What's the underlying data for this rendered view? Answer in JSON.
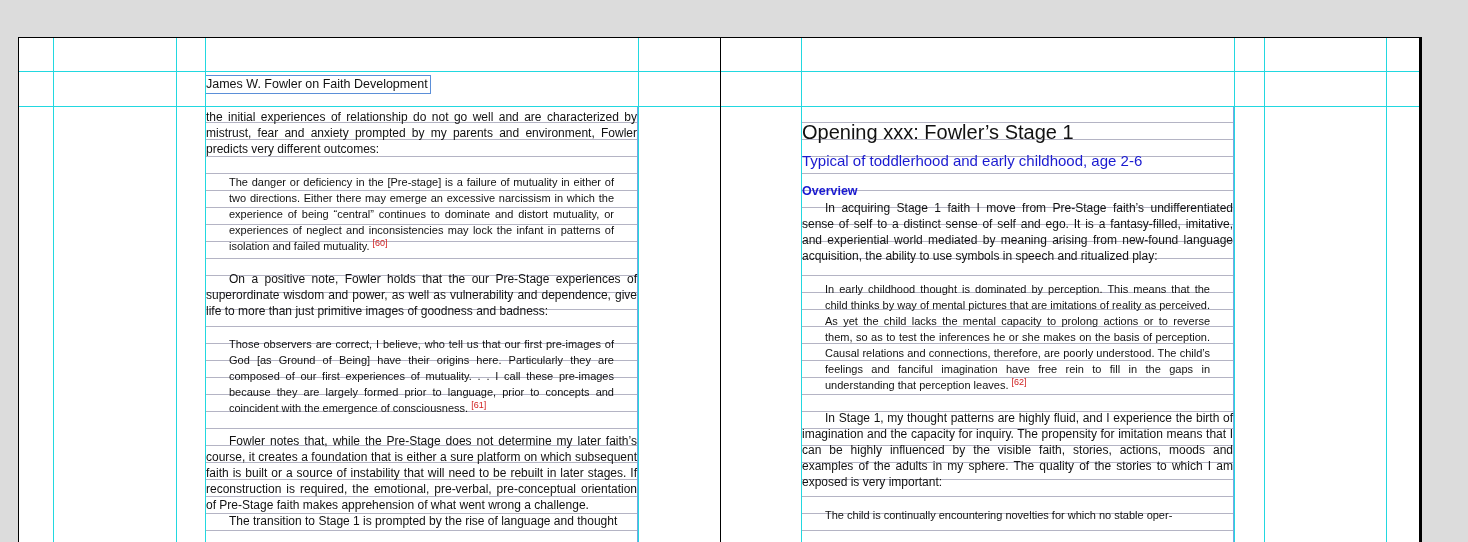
{
  "left_page": {
    "running_head": "James W. Fowler on Faith Development",
    "paragraphs": [
      {
        "kind": "continuation",
        "text": "the initial experiences of relationship do not go well and are characterized by mistrust, fear and anxiety prompted by my parents and environment, Fowler predicts very different outcomes:"
      },
      {
        "kind": "quote",
        "text": "The danger or deficiency in the [Pre-stage] is a failure of mutuality in either of two directions. Either there may emerge an excessive narcissism in which the experience of being “central” continues to dominate and distort mutuality, or experiences of neglect and inconsistencies may lock the infant in patterns of isolation and failed mutuality. $^{[60]}$"
      },
      {
        "kind": "body",
        "text": "On a positive note, Fowler holds that the our Pre-Stage experiences of superordinate wisdom and power, as well as vulnerability and dependence, give life to more than just primitive images of goodness and badness:"
      },
      {
        "kind": "quote",
        "text": "Those observers are correct, I believe, who tell us that our first pre-images of God [as Ground of Being] have their origins here. Particularly they are composed of our first experiences of mutuality. . . I call these pre-images because they are largely formed prior to language, prior to concepts and coincident with the emergence of consciousness. $^{[61]}$"
      },
      {
        "kind": "body",
        "text": "Fowler notes that, while the Pre-Stage does not determine my later faith’s course, it creates a foundation that is either a sure platform on which subsequent faith is built or a source of instability that will need to be rebuilt in later stages. If reconstruction is required, the emotional, pre-verbal, pre-conceptual orientation of Pre-Stage faith makes apprehension of what went wrong a challenge."
      },
      {
        "kind": "body-tight",
        "text": "The transition to Stage 1 is prompted by the rise of language and thought"
      }
    ]
  },
  "right_page": {
    "title": "Opening xxx: Fowler’s Stage 1",
    "subtitle": "Typical of toddlerhood and early childhood, age 2-6",
    "subheading": "Overview",
    "paragraphs": [
      {
        "kind": "body-tight",
        "text": "In acquiring Stage 1 faith I move from Pre-Stage faith’s undifferentiated sense of self to a distinct sense of self and ego. It is a fantasy-filled, imitative, and experiential world mediated by meaning arising from new-found language acquisition, the ability to use symbols in speech and ritualized play:"
      },
      {
        "kind": "quote",
        "text": "In early childhood thought is dominated by perception. This means that the child thinks by way of mental pictures that are imitations of reality as perceived. As yet the child lacks the mental capacity to prolong actions or to reverse them, so as to test the inferences he or she makes on the basis of perception. Causal relations and connections, therefore, are poorly understood. The child’s feelings and fanciful imagination have free rein to fill in the gaps in understanding that perception leaves. $^{[62]}$"
      },
      {
        "kind": "body",
        "text": "In Stage 1, my thought patterns are highly fluid, and I experience the birth of imagination and the capacity for inquiry. The propensity for imitation means that I can be highly influenced by the visible faith, stories, actions, moods and examples of the adults in my sphere. The quality of the stories to which I am exposed is very important:"
      },
      {
        "kind": "quote",
        "text": "The child is continually encountering novelties for which no stable oper-"
      }
    ]
  }
}
